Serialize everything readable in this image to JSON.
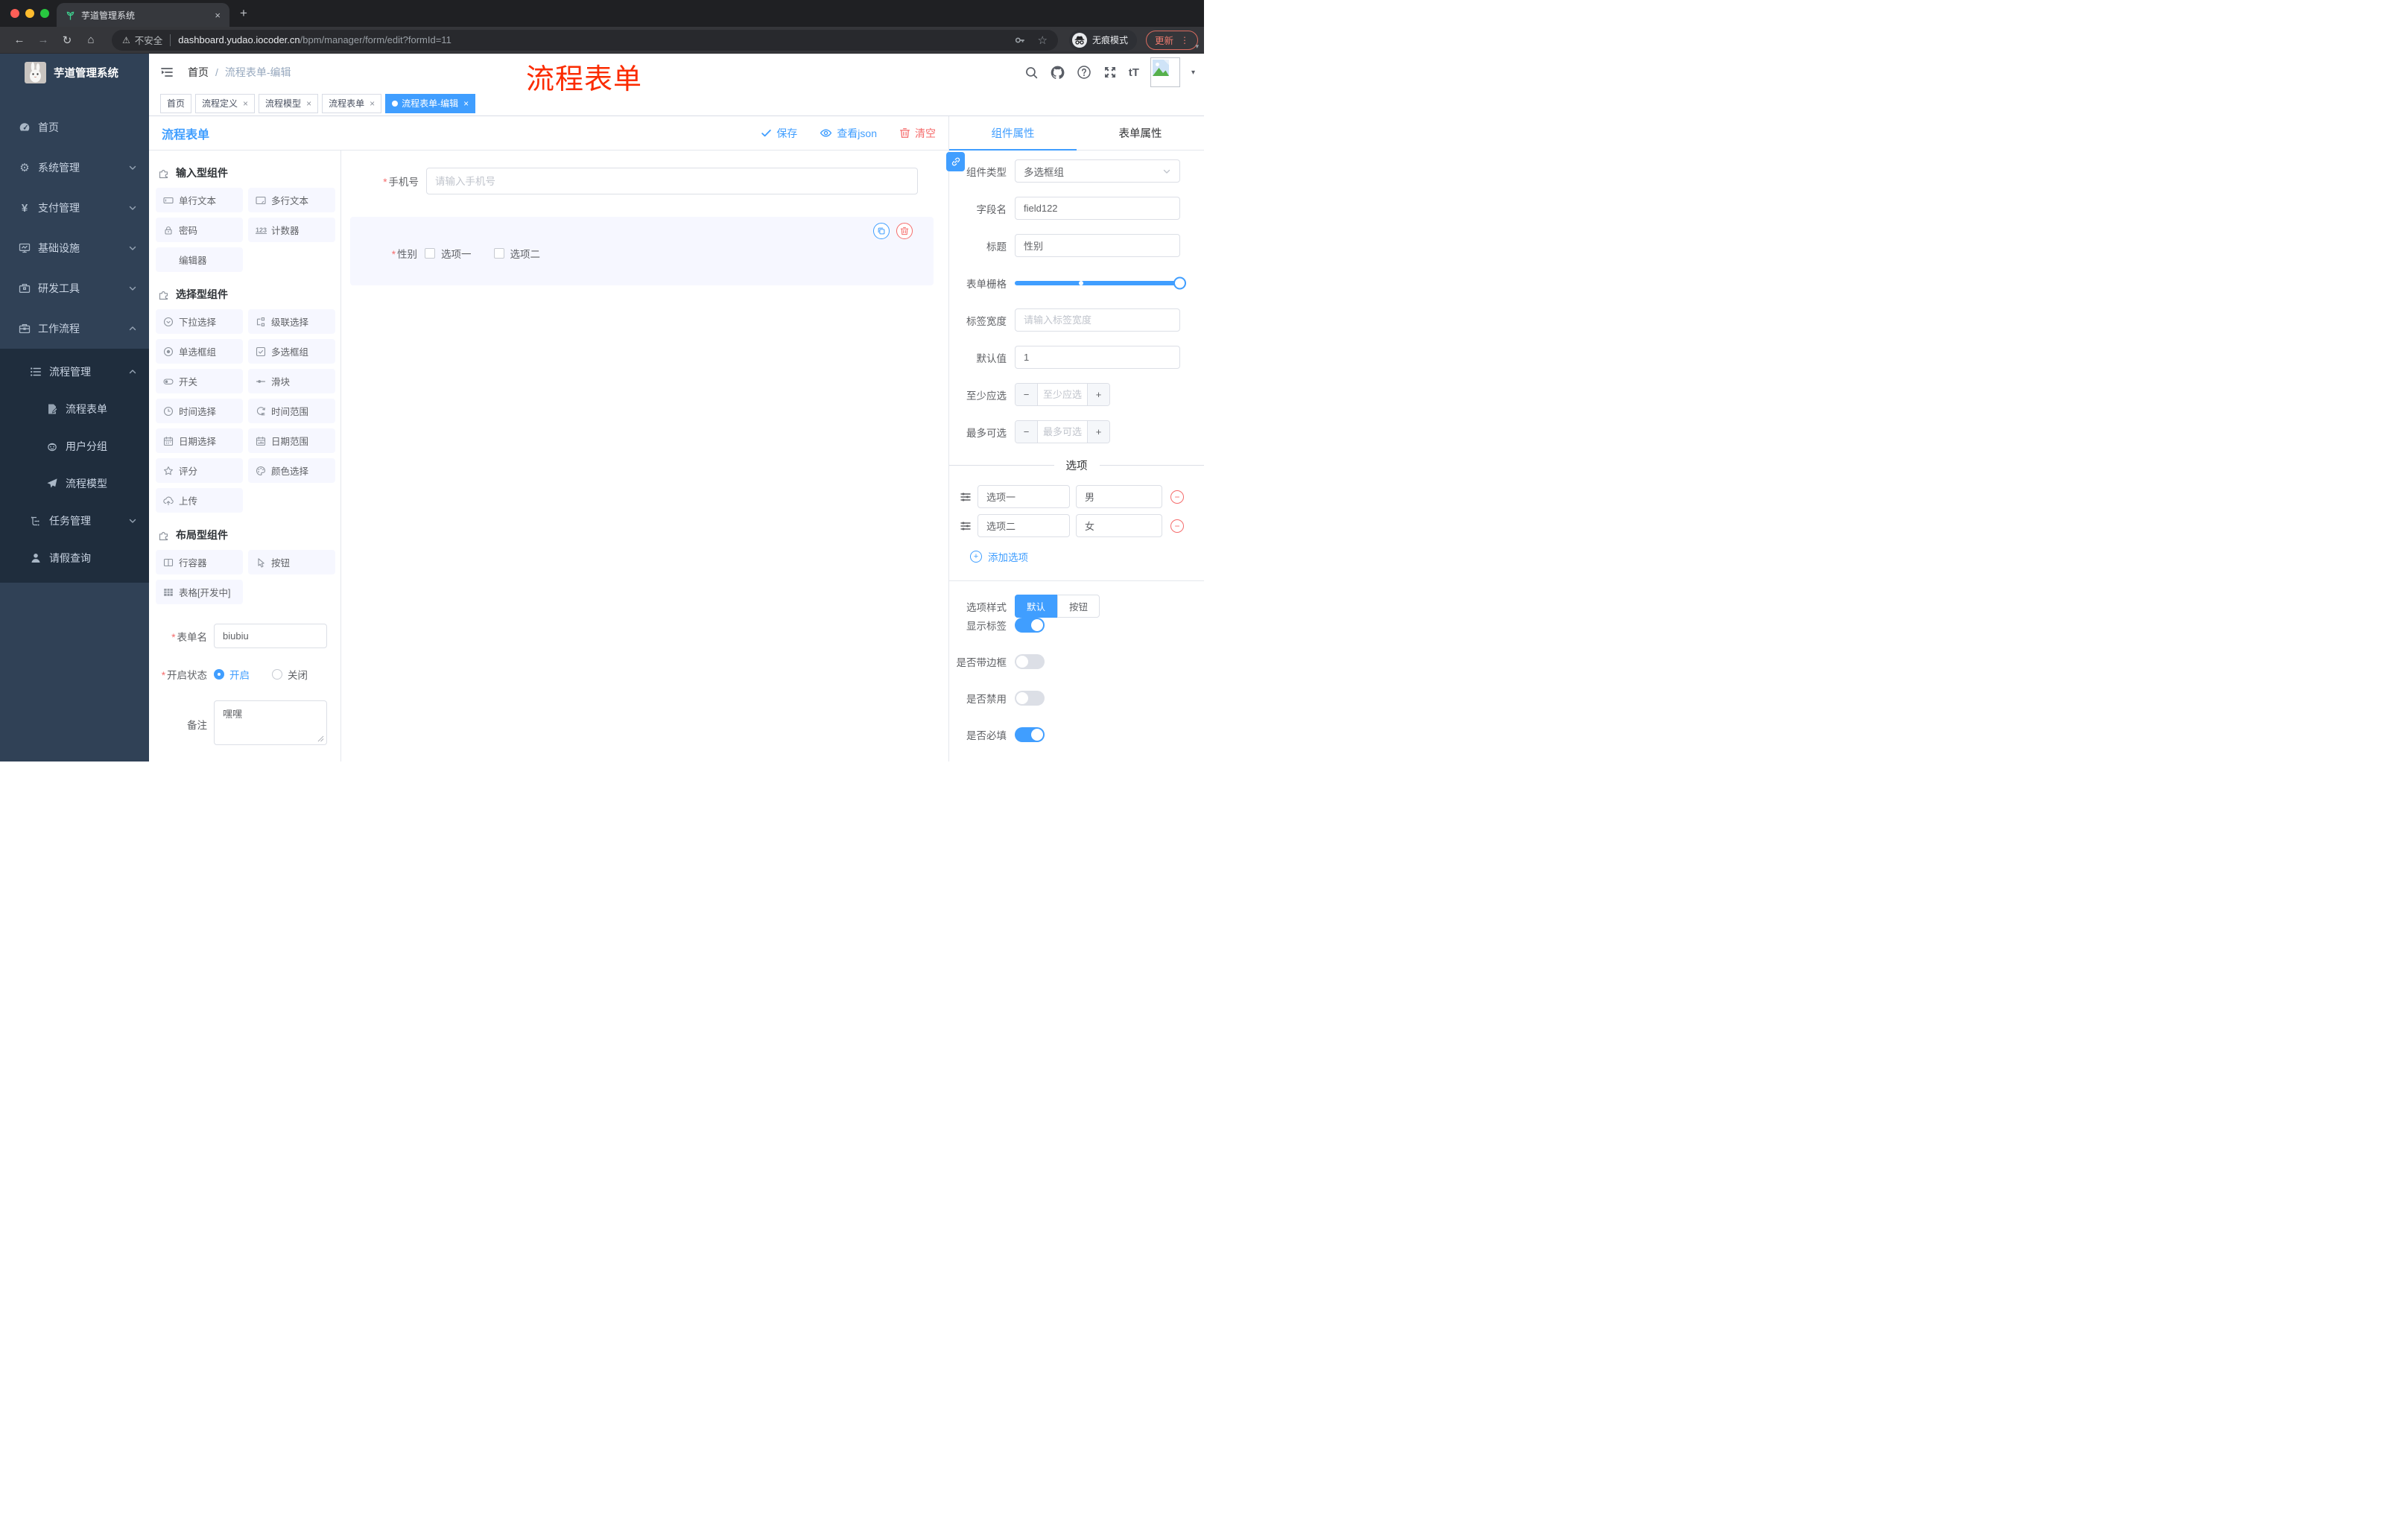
{
  "glyphs": {
    "close": "×",
    "minus": "−",
    "plus": "+",
    "new_tab": "+",
    "breadcrumb_sep": "/",
    "caret_down": "▾",
    "star": "☆",
    "back": "←",
    "forward": "→",
    "reload": "↻",
    "home": "⌂",
    "warning": "⚠",
    "gear": "⚙",
    "yen": "¥",
    "font_size": "tT",
    "ellipsis": "⋮",
    "counter": "123",
    "required": "*",
    "question": "?"
  },
  "browser": {
    "tab_title": "芋道管理系统",
    "security_label": "不安全",
    "url_host": "dashboard.yudao.iocoder.cn",
    "url_path": "/bpm/manager/form/edit?formId=11",
    "incognito_label": "无痕模式",
    "update_label": "更新"
  },
  "sidebar": {
    "app_title": "芋道管理系统",
    "items": [
      {
        "label": "首页",
        "icon": "dashboard-icon"
      },
      {
        "label": "系统管理",
        "icon": "gear-icon"
      },
      {
        "label": "支付管理",
        "icon": "yen-icon"
      },
      {
        "label": "基础设施",
        "icon": "monitor-icon"
      },
      {
        "label": "研发工具",
        "icon": "toolbox-icon"
      },
      {
        "label": "工作流程",
        "icon": "briefcase-icon"
      }
    ],
    "workflow": {
      "process_mgmt_label": "流程管理",
      "children": [
        {
          "label": "流程表单",
          "icon": "document-edit-icon"
        },
        {
          "label": "用户分组",
          "icon": "robot-icon"
        },
        {
          "label": "流程模型",
          "icon": "paper-plane-icon"
        }
      ],
      "task_mgmt_label": "任务管理",
      "leave_query_label": "请假查询"
    }
  },
  "header": {
    "breadcrumb_home": "首页",
    "breadcrumb_current": "流程表单-编辑",
    "annotation": "流程表单",
    "annotation_color": "#fb2b00"
  },
  "tags": [
    {
      "label": "首页",
      "closable": false,
      "active": false
    },
    {
      "label": "流程定义",
      "closable": true,
      "active": false
    },
    {
      "label": "流程模型",
      "closable": true,
      "active": false
    },
    {
      "label": "流程表单",
      "closable": true,
      "active": false
    },
    {
      "label": "流程表单-编辑",
      "closable": true,
      "active": true
    }
  ],
  "designer": {
    "title": "流程表单",
    "actions": {
      "save": "保存",
      "view_json": "查看json",
      "clear": "清空"
    },
    "palette": [
      {
        "title": "输入型组件",
        "items": [
          {
            "label": "单行文本",
            "icon": "input-icon"
          },
          {
            "label": "多行文本",
            "icon": "textarea-icon"
          },
          {
            "label": "密码",
            "icon": "lock-icon"
          },
          {
            "label": "计数器",
            "icon": "counter-icon"
          },
          {
            "label": "编辑器",
            "icon": ""
          }
        ]
      },
      {
        "title": "选择型组件",
        "items": [
          {
            "label": "下拉选择",
            "icon": "select-icon"
          },
          {
            "label": "级联选择",
            "icon": "cascader-icon"
          },
          {
            "label": "单选框组",
            "icon": "radio-icon"
          },
          {
            "label": "多选框组",
            "icon": "checkbox-icon"
          },
          {
            "label": "开关",
            "icon": "switch-icon"
          },
          {
            "label": "滑块",
            "icon": "slider-icon"
          },
          {
            "label": "时间选择",
            "icon": "time-icon"
          },
          {
            "label": "时间范围",
            "icon": "time-range-icon"
          },
          {
            "label": "日期选择",
            "icon": "date-icon"
          },
          {
            "label": "日期范围",
            "icon": "date-range-icon"
          },
          {
            "label": "评分",
            "icon": "star-icon"
          },
          {
            "label": "颜色选择",
            "icon": "palette-icon"
          },
          {
            "label": "上传",
            "icon": "upload-icon"
          }
        ]
      },
      {
        "title": "布局型组件",
        "items": [
          {
            "label": "行容器",
            "icon": "row-container-icon"
          },
          {
            "label": "按钮",
            "icon": "button-icon"
          },
          {
            "label": "表格[开发中]",
            "icon": "table-icon"
          }
        ]
      }
    ],
    "meta": {
      "form_name_label": "表单名",
      "form_name_value": "biubiu",
      "status_label": "开启状态",
      "status_on": "开启",
      "status_off": "关闭",
      "remark_label": "备注",
      "remark_value": "嘿嘿"
    },
    "canvas": {
      "phone_label": "手机号",
      "phone_placeholder": "请输入手机号",
      "gender_label": "性别",
      "gender_option1": "选项一",
      "gender_option2": "选项二"
    }
  },
  "panel": {
    "tab_component": "组件属性",
    "tab_form": "表单属性",
    "component_type_label": "组件类型",
    "component_type_value": "多选框组",
    "field_name_label": "字段名",
    "field_name_value": "field122",
    "title_label": "标题",
    "title_value": "性别",
    "grid_label": "表单栅格",
    "label_width_label": "标签宽度",
    "label_width_placeholder": "请输入标签宽度",
    "default_label": "默认值",
    "default_value": "1",
    "min_label": "至少应选",
    "min_placeholder": "至少应选",
    "max_label": "最多可选",
    "max_placeholder": "最多可选",
    "options_title": "选项",
    "options": [
      {
        "label": "选项一",
        "value": "男"
      },
      {
        "label": "选项二",
        "value": "女"
      }
    ],
    "add_option": "添加选项",
    "style_label": "选项样式",
    "style_default": "默认",
    "style_button": "按钮",
    "show_label_label": "显示标签",
    "border_label": "是否带边框",
    "disabled_label": "是否禁用",
    "required_label": "是否必填"
  },
  "colors": {
    "primary": "#409eff",
    "danger": "#f56c6c",
    "sidebar_bg": "#304156",
    "submenu_bg": "#1f2d3d",
    "annotation": "#fb2b00"
  }
}
